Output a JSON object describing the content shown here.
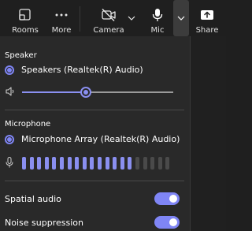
{
  "toolbar": {
    "rooms_label": "Rooms",
    "more_label": "More",
    "camera_label": "Camera",
    "mic_label": "Mic",
    "share_label": "Share"
  },
  "speaker": {
    "title": "Speaker",
    "device": "Speakers (Realtek(R) Audio)",
    "volume_percent": 42
  },
  "microphone": {
    "title": "Microphone",
    "device": "Microphone Array (Realtek(R) Audio)",
    "level_bars_total": 20,
    "level_bars_active": 15
  },
  "toggles": {
    "spatial_audio": {
      "label": "Spatial audio",
      "on": true
    },
    "noise_suppression": {
      "label": "Noise suppression",
      "on": true
    }
  },
  "colors": {
    "accent": "#7f85f5",
    "background": "#292929",
    "toolbar": "#1f1f1f"
  },
  "icons": [
    "rooms-icon",
    "more-icon",
    "camera-off-icon",
    "mic-icon",
    "share-icon",
    "chevron-down-icon",
    "speaker-icon",
    "microphone-icon"
  ]
}
